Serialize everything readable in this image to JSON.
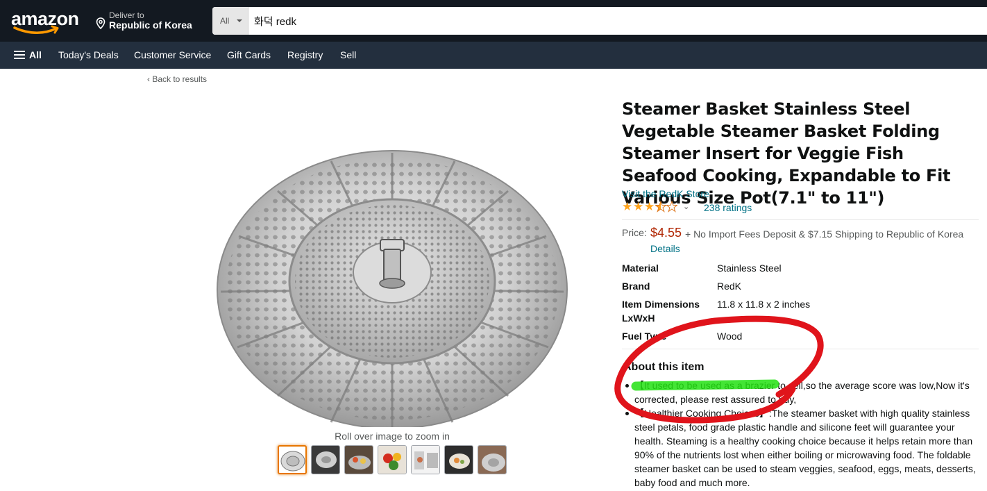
{
  "header": {
    "logo_text": "amazon",
    "deliver_line1": "Deliver to",
    "deliver_line2": "Republic of Korea",
    "search_category": "All",
    "search_value": "화덕 redk"
  },
  "subnav": {
    "all_label": "All",
    "items": [
      "Today's Deals",
      "Customer Service",
      "Gift Cards",
      "Registry",
      "Sell"
    ]
  },
  "breadcrumb": {
    "back": "‹ Back to results"
  },
  "gallery": {
    "zoom_hint": "Roll over image to zoom in",
    "thumb_count": 7
  },
  "product": {
    "title": "Steamer Basket Stainless Steel Vegetable Steamer Basket Folding Steamer Insert for Veggie Fish Seafood Cooking, Expandable to Fit Various Size Pot(7.1\" to 11\")",
    "store_link": "Visit the RedK Store",
    "rating_stars": 3.5,
    "ratings_count": "238 ratings",
    "price_label": "Price:",
    "price": "$4.55",
    "shipping": "+ No Import Fees Deposit & $7.15 Shipping to Republic of Korea",
    "details_link": "Details",
    "specs": [
      {
        "key": "Material",
        "value": "Stainless Steel"
      },
      {
        "key": "Brand",
        "value": "RedK"
      },
      {
        "key": "Item Dimensions LxWxH",
        "value": "11.8 x 11.8 x 2 inches"
      },
      {
        "key": "Fuel Type",
        "value": "Wood"
      }
    ],
    "about_heading": "About this item",
    "bullets": [
      "【It used to be used as a brazier to sell,so the average score was low,Now it's corrected, please rest assured to buy,",
      "【Healthier Cooking Choices】:The steamer basket with high quality stainless steel petals, food grade plastic handle and silicone feet will guarantee your health. Steaming is a healthy cooking choice because it helps retain more than 90% of the nutrients lost when either boiling or microwaving food. The foldable steamer basket can be used to steam veggies, seafood, eggs, meats, desserts, baby food and much more."
    ]
  },
  "colors": {
    "nav_dark": "#131921",
    "nav_sub": "#232f3e",
    "link": "#007185",
    "price": "#b12704",
    "star": "#ffa41c",
    "annotation_circle": "#e0141b",
    "annotation_highlight": "#22e012"
  }
}
